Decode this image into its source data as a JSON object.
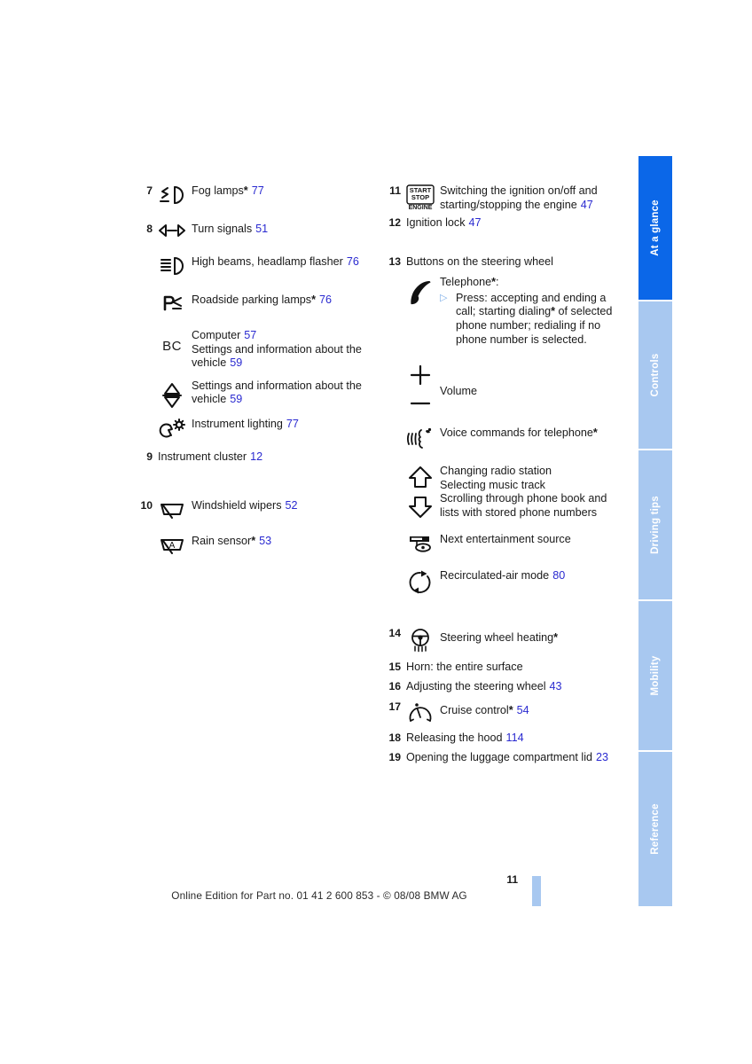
{
  "document": {
    "page_number": "11",
    "footer_text": "Online Edition for Part no. 01 41 2 600 853 - © 08/08 BMW AG"
  },
  "sidebar": {
    "tabs": [
      {
        "label": "At a glance",
        "active": true
      },
      {
        "label": "Controls",
        "active": false
      },
      {
        "label": "Driving tips",
        "active": false
      },
      {
        "label": "Mobility",
        "active": false
      },
      {
        "label": "Reference",
        "active": false
      }
    ]
  },
  "colors": {
    "accent": "#0b67e8",
    "tab_inactive": "#a8c8f0",
    "page_ref": "#2a2ad0",
    "bullet": "#7fb0e8"
  },
  "left_column": {
    "entries": [
      {
        "num": "7",
        "icon": "fog-lamps-icon",
        "label": "Fog lamps",
        "star": "*",
        "ref": "77"
      },
      {
        "num": "8",
        "icon": "turn-signals-icon",
        "label": "Turn signals",
        "star": "",
        "ref": "51"
      },
      {
        "num": "",
        "icon": "high-beams-icon",
        "label": "High beams, headlamp flasher",
        "star": "",
        "ref": "76"
      },
      {
        "num": "",
        "icon": "roadside-parking-lamps-icon",
        "label": "Roadside parking lamps",
        "star": "*",
        "ref": "76"
      },
      {
        "num": "",
        "icon": "bc-computer-icon",
        "label": "Computer",
        "star": "",
        "ref": "57",
        "label2": "Settings and information about the vehicle",
        "ref2": "59"
      },
      {
        "num": "",
        "icon": "up-down-arrows-icon",
        "label": "Settings and information about the vehicle",
        "star": "",
        "ref": "59"
      },
      {
        "num": "",
        "icon": "instrument-lighting-icon",
        "label": "Instrument lighting",
        "star": "",
        "ref": "77"
      },
      {
        "num": "9",
        "icon": "",
        "label": "Instrument cluster",
        "star": "",
        "ref": "12"
      },
      {
        "num": "10",
        "icon": "windshield-wipers-icon",
        "label": "Windshield wipers",
        "star": "",
        "ref": "52"
      },
      {
        "num": "",
        "icon": "rain-sensor-icon",
        "label": "Rain sensor",
        "star": "*",
        "ref": "53"
      }
    ]
  },
  "right_column": {
    "entry_11": {
      "num": "11",
      "icon": "start-stop-engine-icon",
      "label": "Switching the ignition on/off and starting/stopping the engine",
      "ref": "47",
      "icon_text": {
        "line1": "START",
        "line2": "STOP",
        "line3": "ENGINE"
      }
    },
    "entry_12": {
      "num": "12",
      "label": "Ignition lock",
      "ref": "47"
    },
    "entry_13": {
      "num": "13",
      "label": "Buttons on the steering wheel"
    },
    "telephone": {
      "icon": "telephone-handset-icon",
      "label": "Telephone",
      "star": "*",
      "colon": ":",
      "bullet": "▷",
      "detail": "Press: accepting and ending a call; starting dialing",
      "detail_star": "*",
      "detail_rest": " of selected phone number; redialing if no phone number is selected."
    },
    "volume": {
      "icon": "plus-minus-volume-icon",
      "label": "Volume"
    },
    "voice": {
      "icon": "voice-command-icon",
      "label": "Voice commands for telephone",
      "star": "*"
    },
    "updown": {
      "icon": "up-down-chevron-icon",
      "lines": [
        "Changing radio station",
        "Selecting music track",
        "Scrolling through phone book and",
        "lists with stored phone numbers"
      ]
    },
    "entertainment": {
      "icon": "entertainment-source-icon",
      "label": "Next entertainment source"
    },
    "recirculated": {
      "icon": "recirculated-air-icon",
      "label": "Recirculated-air mode",
      "ref": "80"
    },
    "entry_14": {
      "num": "14",
      "icon": "steering-wheel-heating-icon",
      "label": "Steering wheel heating",
      "star": "*"
    },
    "entry_15": {
      "num": "15",
      "label": "Horn: the entire surface"
    },
    "entry_16": {
      "num": "16",
      "label": "Adjusting the steering wheel",
      "ref": "43"
    },
    "entry_17": {
      "num": "17",
      "icon": "cruise-control-icon",
      "label": "Cruise control",
      "star": "*",
      "ref": "54"
    },
    "entry_18": {
      "num": "18",
      "label": "Releasing the hood",
      "ref": "114"
    },
    "entry_19": {
      "num": "19",
      "label": "Opening the luggage compartment lid",
      "ref": "23"
    }
  }
}
